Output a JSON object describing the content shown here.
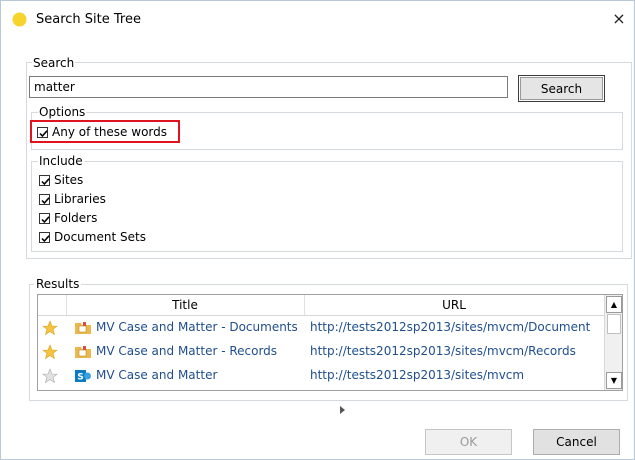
{
  "window": {
    "title": "Search Site Tree",
    "close_glyph": "×",
    "icon": "yellow-circle-icon"
  },
  "search": {
    "legend": "Search",
    "query_value": "matter",
    "button_label": "Search"
  },
  "options": {
    "legend": "Options",
    "any_words_label": "Any of these words",
    "any_words_checked": true
  },
  "include": {
    "legend": "Include",
    "items": [
      {
        "label": "Sites",
        "checked": true
      },
      {
        "label": "Libraries",
        "checked": true
      },
      {
        "label": "Folders",
        "checked": true
      },
      {
        "label": "Document Sets",
        "checked": true
      }
    ]
  },
  "results": {
    "legend": "Results",
    "columns": {
      "title": "Title",
      "url": "URL"
    },
    "rows": [
      {
        "star": "gold-star-icon",
        "icon": "library-folder-icon",
        "title": "MV Case and Matter - Documents",
        "url": "http://tests2012sp2013/sites/mvcm/Document"
      },
      {
        "star": "gold-star-icon",
        "icon": "library-folder-icon",
        "title": "MV Case and Matter - Records",
        "url": "http://tests2012sp2013/sites/mvcm/Records"
      },
      {
        "star": "gray-star-icon",
        "icon": "sharepoint-site-icon",
        "title": "MV Case and Matter",
        "url": "http://tests2012sp2013/sites/mvcm"
      }
    ]
  },
  "footer": {
    "ok_label": "OK",
    "cancel_label": "Cancel",
    "ok_enabled": false
  },
  "colors": {
    "highlight": "#e0141e",
    "link": "#1f4e8c",
    "star_gold": "#f5c242",
    "star_gray": "#c8c8c8"
  }
}
